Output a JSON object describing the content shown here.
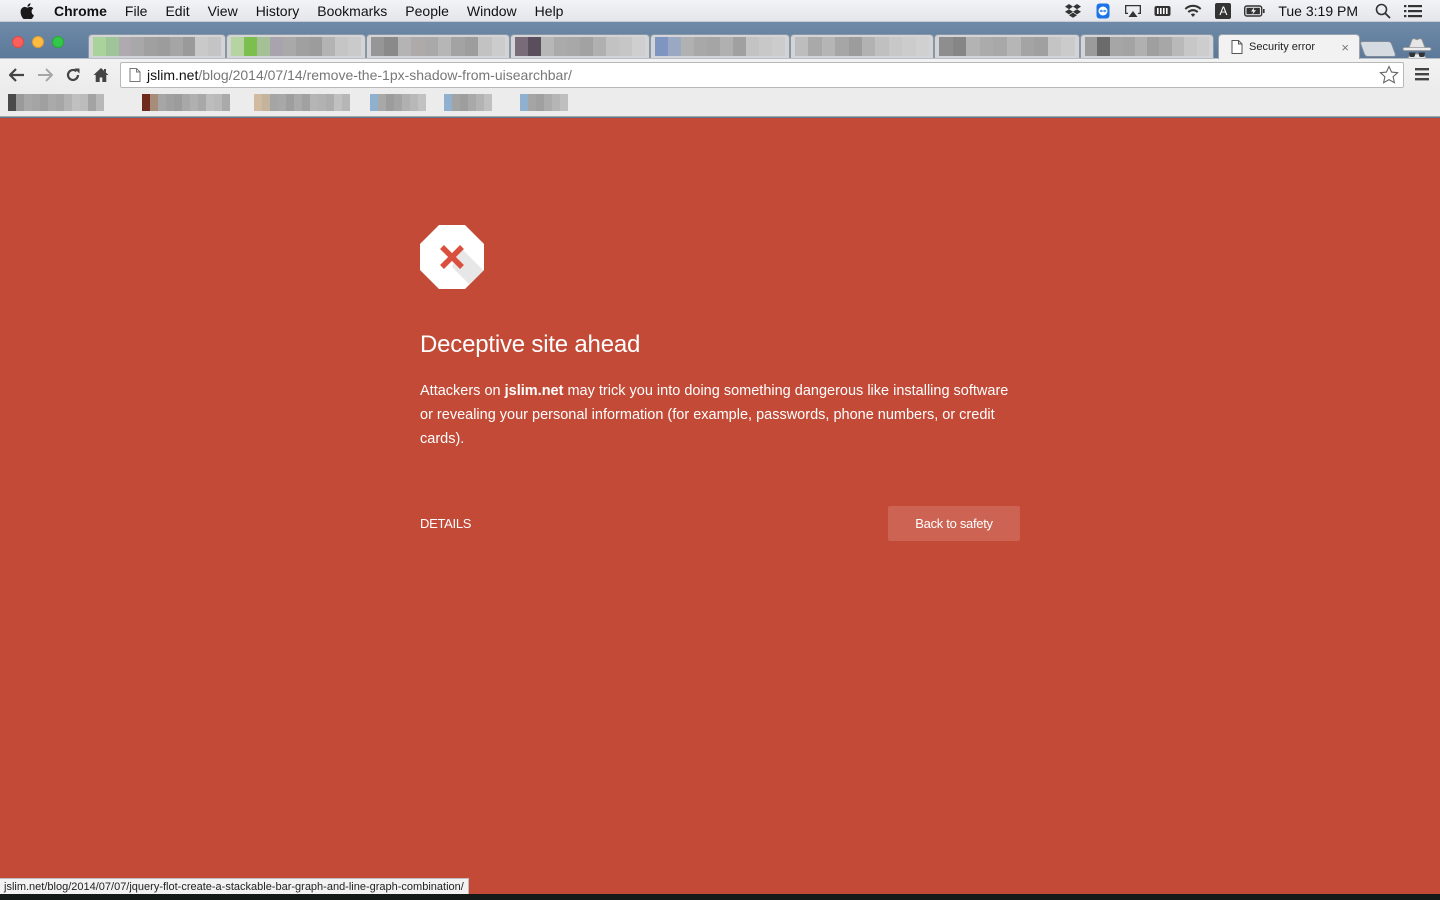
{
  "menubar": {
    "app_name": "Chrome",
    "items": [
      "File",
      "Edit",
      "View",
      "History",
      "Bookmarks",
      "People",
      "Window",
      "Help"
    ],
    "status_icons": [
      "dropbox-icon",
      "teamviewer-icon",
      "airplay-icon",
      "battery-meter-icon",
      "wifi-icon",
      "input-source-icon",
      "battery-charging-icon"
    ],
    "input_source_label": "A",
    "clock": "Tue 3:19 PM",
    "spotlight_icon": "search-icon",
    "notification_icon": "list-icon"
  },
  "browser": {
    "tabs": [
      {
        "label": "",
        "blurred": true,
        "colors": [
          "#a9d39a",
          "#9fc49a",
          "#b0aab0",
          "#a8a8a8",
          "#a0a0a0",
          "#9c9c9c",
          "#a5a5a5",
          "#9a9a9a",
          "#c9c9c9",
          "#c4c4c4"
        ]
      },
      {
        "label": "",
        "blurred": true,
        "colors": [
          "#b5d4a2",
          "#7dbf4f",
          "#a5c096",
          "#a8a3ad",
          "#a9a9a9",
          "#a0a0a0",
          "#9c9c9c",
          "#b3b3b3",
          "#c5c5c5",
          "#cacaca"
        ]
      },
      {
        "label": "",
        "blurred": true,
        "colors": [
          "#969696",
          "#8a8a8a",
          "#b4b4b4",
          "#aeaaaa",
          "#a9a9a9",
          "#b6b6b6",
          "#a3a3a3",
          "#9d9d9d",
          "#c2c2c2",
          "#cccccc"
        ]
      },
      {
        "label": "",
        "blurred": true,
        "colors": [
          "#7a6b78",
          "#5b4e5c",
          "#b7b7b7",
          "#aaaaaa",
          "#a8a8a8",
          "#a2a2a2",
          "#b0b0b0",
          "#c2c2c2",
          "#c6c6c6",
          "#cfcfcf"
        ]
      },
      {
        "label": "",
        "blurred": true,
        "colors": [
          "#7d95c0",
          "#9aa8c4",
          "#b1b1b1",
          "#a8a8a8",
          "#a5a5a5",
          "#b0b0b0",
          "#a0a0a0",
          "#c3c3c3",
          "#c8c8c8",
          "#cccccc"
        ]
      },
      {
        "label": "",
        "blurred": true,
        "colors": [
          "#bdbdbd",
          "#a9a9a9",
          "#b5b5b5",
          "#a6a6a6",
          "#9c9c9c",
          "#b2b2b2",
          "#c0c0c0",
          "#c8c8c8",
          "#cccccc",
          "#d0d0d0"
        ]
      },
      {
        "label": "",
        "blurred": true,
        "colors": [
          "#8e8e8e",
          "#868686",
          "#b3b3b3",
          "#ababab",
          "#a8a8a8",
          "#b6b6b6",
          "#a4a4a4",
          "#a0a0a0",
          "#c4c4c4",
          "#cbcbcb"
        ]
      },
      {
        "label": "",
        "blurred": true,
        "colors": [
          "#9b9b9b",
          "#6b6b6b",
          "#a6a6a6",
          "#a3a3a3",
          "#b0b0b0",
          "#9f9f9f",
          "#a7a7a7",
          "#b9b9b9",
          "#c7c7c7",
          "#cdcdcd"
        ]
      }
    ],
    "active_tab": {
      "label": "Security error",
      "icon": "page-icon",
      "close": "×"
    },
    "url_host": "jslim.net",
    "url_path": "/blog/2014/07/14/remove-the-1px-shadow-from-uisearchbar/",
    "bookmarks": [
      {
        "colors": [
          "#4a4a4a",
          "#9a9a9a",
          "#a8a8a8",
          "#a5a5a5",
          "#a0a0a0",
          "#aaaaaa",
          "#a6a6a6",
          "#b3b3b3",
          "#c0c0c0",
          "#bcbcbc",
          "#a3a3a3",
          "#b8b8b8"
        ]
      },
      {
        "colors": [
          "#6e2a1a",
          "#a78c7a",
          "#a6a6a6",
          "#a0a0a0",
          "#9c9c9c",
          "#a8a8a8",
          "#b0b0b0",
          "#a8a8a8",
          "#bdbdbd",
          "#b9b9b9",
          "#aaaaaa"
        ]
      },
      {
        "colors": [
          "#d1bba0",
          "#c4b49e",
          "#a5a5a5",
          "#a8a8a8",
          "#9e9e9e",
          "#aaaaaa",
          "#a1a1a1",
          "#b5b5b5",
          "#b2b2b2",
          "#adadad",
          "#c0c0c0",
          "#b6b6b6"
        ]
      },
      {
        "colors": [
          "#8fb0cf",
          "#a8a8a8",
          "#9c9c9c",
          "#a4a4a4",
          "#b0b0b0",
          "#b8b8b8",
          "#c2c2c2"
        ]
      },
      {
        "colors": [
          "#8fb0cf",
          "#a3a3a3",
          "#9e9e9e",
          "#a9a9a9",
          "#b3b3b3",
          "#c0c0c0"
        ]
      },
      {
        "colors": [
          "#8fb0cf",
          "#a5a5a5",
          "#a0a0a0",
          "#acacac",
          "#b5b5b5",
          "#bfbfbf"
        ]
      }
    ],
    "status_url": "jslim.net/blog/2014/07/07/jquery-flot-create-a-stackable-bar-graph-and-line-graph-combination/"
  },
  "interstitial": {
    "background_color": "#c24a37",
    "icon": "stop-sign-x-icon",
    "heading": "Deceptive site ahead",
    "message_prefix": "Attackers on ",
    "message_host": "jslim.net",
    "message_suffix": " may trick you into doing something dangerous like installing software or revealing your personal information (for example, passwords, phone numbers, or credit cards).",
    "details_label": "DETAILS",
    "primary_button_label": "Back to safety"
  }
}
